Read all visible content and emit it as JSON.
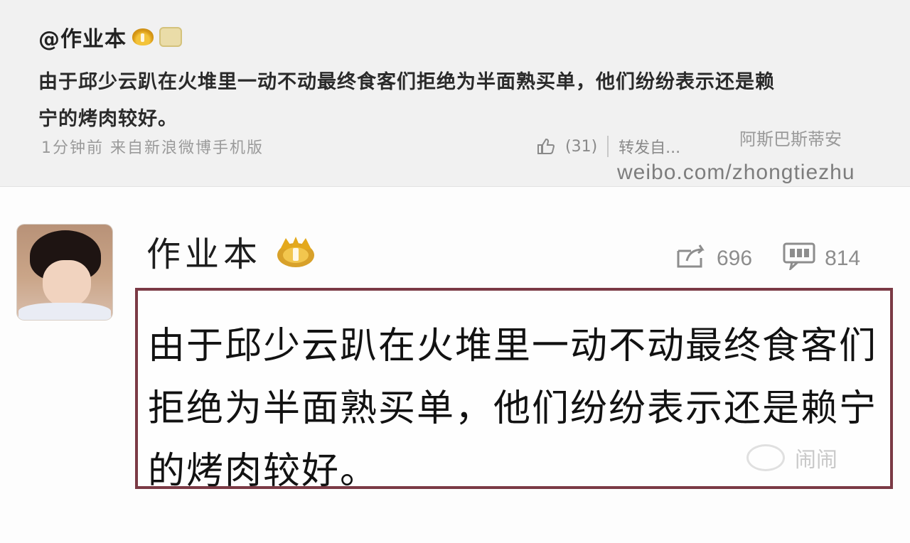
{
  "top_card": {
    "username": "@作业本",
    "text_line1": "由于邱少云趴在火堆里一动不动最终食客们拒绝为半面熟买单，他们纷纷表示还是赖",
    "text_line2": "宁的烤肉较好。",
    "meta": "1分钟前 来自新浪微博手机版",
    "like_count": "(31)",
    "forward_label": "转发自...",
    "source": "阿斯巴斯蒂安",
    "watermark": "weibo.com/zhongtiezhu"
  },
  "post": {
    "username": "作业本",
    "repost_count": "696",
    "comment_count": "814",
    "content": "由于邱少云趴在火堆里一动不动最终食客们拒绝为半面熟买单，他们纷纷表示还是赖宁的烤肉较好。",
    "watermark": "闹闹"
  },
  "colors": {
    "quote_border": "#7b3a45",
    "crown": "#e4a91c"
  }
}
